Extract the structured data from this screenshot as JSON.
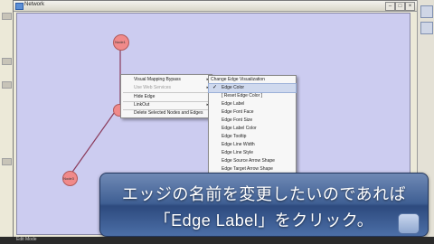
{
  "window": {
    "title": "Network"
  },
  "nodes": [
    {
      "label": "Node1"
    },
    {
      "label": ""
    },
    {
      "label": "Node3"
    }
  ],
  "context_menu": {
    "items": [
      {
        "label": "Visual Mapping Bypass",
        "submenu": true
      },
      {
        "label": "Use Web Services",
        "submenu": true,
        "disabled": true
      },
      {
        "label": "Hide Edge"
      },
      {
        "label": "LinkOut",
        "submenu": true
      },
      {
        "label": "Delete Selected Nodes and Edges"
      }
    ]
  },
  "submenu": {
    "items": [
      {
        "label": "Change Edge Visualization"
      },
      {
        "label": "Edge Color",
        "checked": true
      },
      {
        "label": "[ Reset Edge Color ]"
      },
      {
        "label": "Edge Label"
      },
      {
        "label": "Edge Font Face"
      },
      {
        "label": "Edge Font Size"
      },
      {
        "label": "Edge Label Color"
      },
      {
        "label": "Edge Tooltip"
      },
      {
        "label": "Edge Line Width"
      },
      {
        "label": "Edge Line Style"
      },
      {
        "label": "Edge Source Arrow Shape"
      },
      {
        "label": "Edge Target Arrow Shape"
      }
    ],
    "check_mark": "✓"
  },
  "caption": {
    "line1": "エッジの名前を変更したいのであれば",
    "line2": "「Edge Label」をクリック。"
  },
  "status": {
    "text": "Edit Mode"
  },
  "colors": {
    "canvas_bg": "#ccccf0",
    "node_fill": "#f08a8a",
    "edge_color": "#8a3a5a",
    "banner": "#3f5f93"
  }
}
